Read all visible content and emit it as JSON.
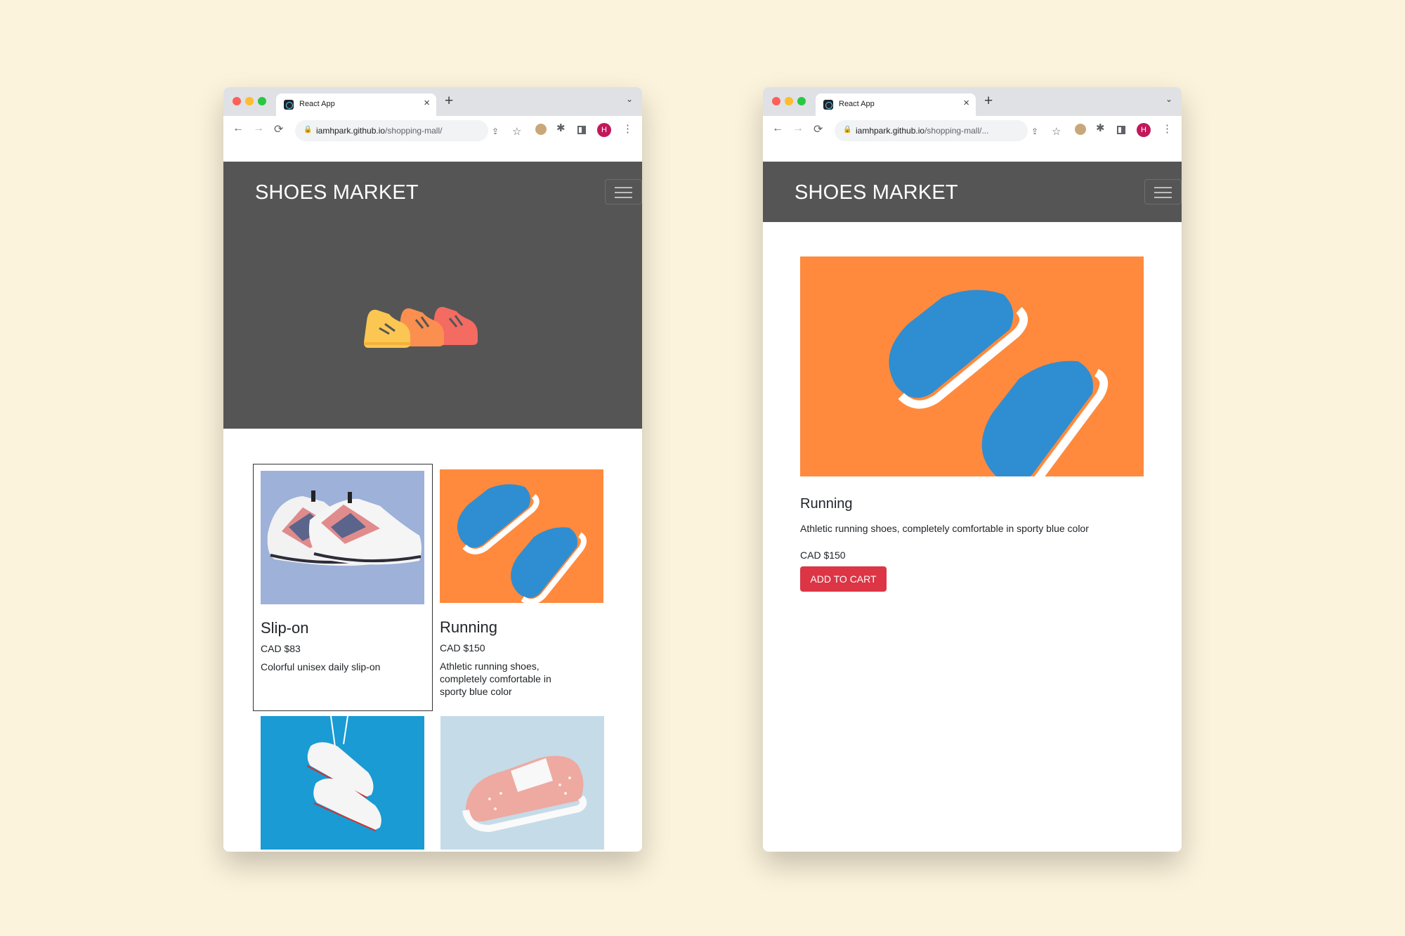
{
  "browser": {
    "tab_title": "React App",
    "tab_close": "×",
    "new_tab": "+",
    "tab_menu": "⌄",
    "back": "←",
    "forward": "→",
    "reload": "⟳",
    "lock": "🔒",
    "share": "⇪",
    "star": "☆",
    "puzzle": "✱",
    "kebab": "⋮",
    "avatar_letter": "H",
    "left_url_domain": "iamhpark.github.io",
    "left_url_path": "/shopping-mall/",
    "right_url_domain": "iamhpark.github.io",
    "right_url_path": "/shopping-mall/..."
  },
  "navbar": {
    "brand": "SHOES MARKET"
  },
  "products": [
    {
      "title": "Slip-on",
      "price": "CAD $83",
      "description": "Colorful unisex daily slip-on"
    },
    {
      "title": "Running",
      "price": "CAD $150",
      "description": "Athletic running shoes, completely comfortable in sporty blue color"
    }
  ],
  "detail": {
    "title": "Running",
    "description": "Athletic running shoes, completely comfortable in sporty blue color",
    "price": "CAD $150",
    "button": "ADD TO CART"
  },
  "colors": {
    "background": "#fcf3dc",
    "navbar": "#555555",
    "button": "#dc3545",
    "orange": "#ff8a3d",
    "slipon_bg": "#9db1d9",
    "canvas_bg": "#1a9bd3",
    "pink_bg": "#c5dbe8"
  },
  "icons": [
    "react-favicon",
    "back-arrow-icon",
    "forward-arrow-icon",
    "reload-icon",
    "lock-icon",
    "share-icon",
    "star-icon",
    "extensions-icon",
    "sidepanel-icon",
    "menu-icon",
    "hamburger-icon"
  ]
}
